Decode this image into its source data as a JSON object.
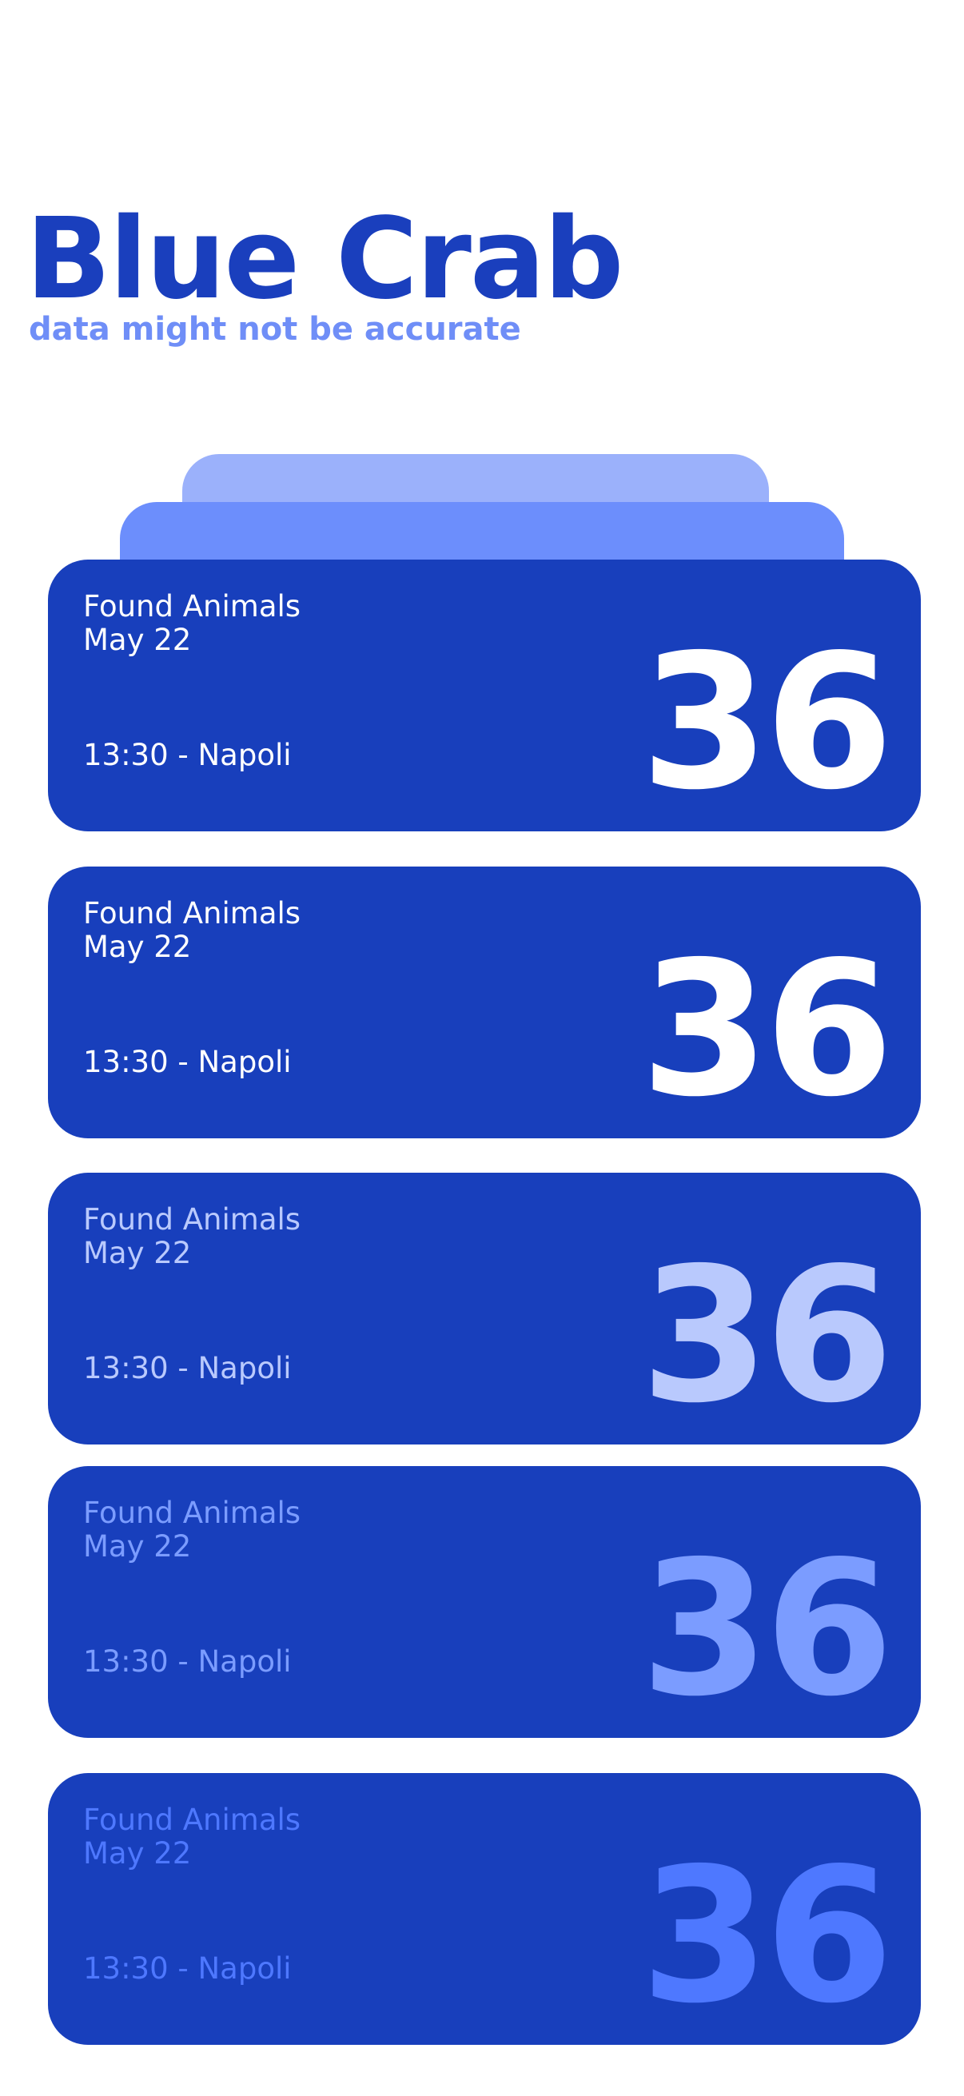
{
  "header": {
    "title": "Blue Crab",
    "subtitle": "data might not be accurate"
  },
  "colors": {
    "brand": "#1a3fbd",
    "subtitle": "#6f8ef7",
    "card_background": "#183fbc",
    "stack_back": "#9bb1fb",
    "stack_front": "#6c8efc",
    "card_text_levels": [
      "#ffffff",
      "#ffffff",
      "#b9c9fd",
      "#7b9cff",
      "#4e78ff"
    ]
  },
  "cards": [
    {
      "title": "Found Animals",
      "date": "May 22",
      "footer": "13:30 - Napoli",
      "count": "36"
    },
    {
      "title": "Found Animals",
      "date": "May 22",
      "footer": "13:30 - Napoli",
      "count": "36"
    },
    {
      "title": "Found Animals",
      "date": "May 22",
      "footer": "13:30 - Napoli",
      "count": "36"
    },
    {
      "title": "Found Animals",
      "date": "May 22",
      "footer": "13:30 - Napoli",
      "count": "36"
    },
    {
      "title": "Found Animals",
      "date": "May 22",
      "footer": "13:30 - Napoli",
      "count": "36"
    }
  ]
}
